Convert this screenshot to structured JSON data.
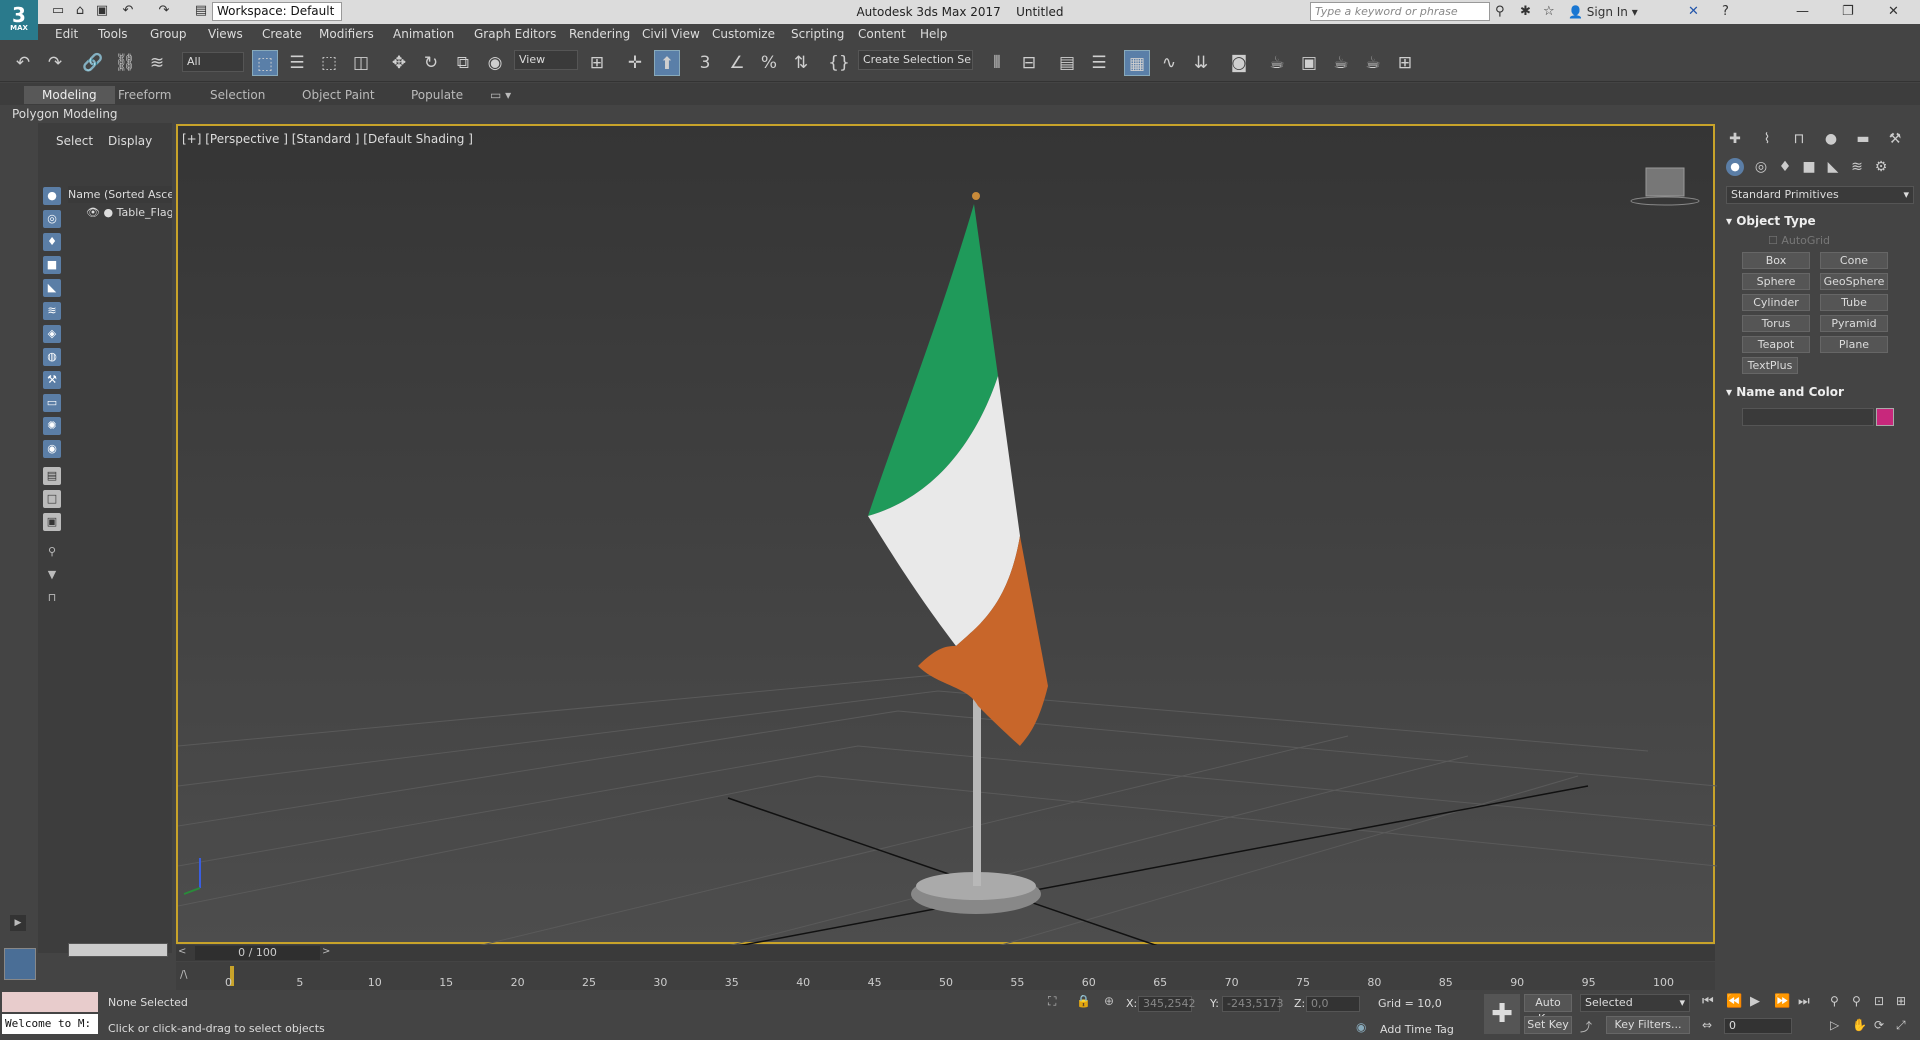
{
  "app": {
    "title": "Autodesk 3ds Max 2017",
    "document": "Untitled",
    "logo_main": "3",
    "logo_sub": "MAX"
  },
  "workspace": {
    "label": "Workspace: Default"
  },
  "search": {
    "placeholder": "Type a keyword or phrase"
  },
  "account": {
    "sign_in": "Sign In"
  },
  "menus": [
    "Edit",
    "Tools",
    "Group",
    "Views",
    "Create",
    "Modifiers",
    "Animation",
    "Graph Editors",
    "Rendering",
    "Civil View",
    "Customize",
    "Scripting",
    "Content",
    "Help"
  ],
  "toolbar": {
    "filter": "All",
    "ref_coord": "View",
    "selection_set": "Create Selection Se"
  },
  "ribbon": {
    "tabs": [
      "Modeling",
      "Freeform",
      "Selection",
      "Object Paint",
      "Populate"
    ],
    "sub": "Polygon Modeling"
  },
  "scene_explorer": {
    "tabs": [
      "Select",
      "Display"
    ],
    "column": "Name (Sorted Ascen",
    "items": [
      "Table_Flag"
    ]
  },
  "viewport": {
    "label": "[+] [Perspective ] [Standard ] [Default Shading ]"
  },
  "command_panel": {
    "category": "Standard Primitives",
    "object_type": "Object Type",
    "autogrid": "AutoGrid",
    "buttons": [
      "Box",
      "Cone",
      "Sphere",
      "GeoSphere",
      "Cylinder",
      "Tube",
      "Torus",
      "Pyramid",
      "Teapot",
      "Plane",
      "TextPlus"
    ],
    "name_and_color": "Name and Color",
    "object_color": "#c8287c"
  },
  "timeline": {
    "frame": "0 / 100",
    "ticks": [
      "0",
      "5",
      "10",
      "15",
      "20",
      "25",
      "30",
      "35",
      "40",
      "45",
      "50",
      "55",
      "60",
      "65",
      "70",
      "75",
      "80",
      "85",
      "90",
      "95",
      "100"
    ]
  },
  "status": {
    "maxscript": "Welcome to M:",
    "selection": "None Selected",
    "prompt": "Click or click-and-drag to select objects",
    "x_label": "X:",
    "x": "345,2542",
    "y_label": "Y:",
    "y": "-243,5173",
    "z_label": "Z:",
    "z": "0,0",
    "grid": "Grid = 10,0",
    "add_time_tag": "Add Time Tag",
    "auto_key": "Auto Key",
    "set_key": "Set Key",
    "key_mode": "Selected",
    "key_filters": "Key Filters...",
    "current_frame": "0"
  }
}
